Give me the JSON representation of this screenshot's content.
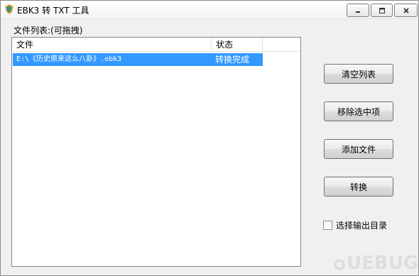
{
  "window": {
    "title": "EBK3 转 TXT 工具"
  },
  "list": {
    "caption": "文件列表:(可拖拽)",
    "columns": [
      "文件",
      "状态"
    ],
    "rows": [
      {
        "file": "E:\\《历史原来这么八卦》.ebk3",
        "status": "转换完成",
        "selected": true
      }
    ]
  },
  "buttons": {
    "clear": "清空列表",
    "remove": "移除选中项",
    "add": "添加文件",
    "convert": "转换"
  },
  "options": {
    "select_output_dir": "选择输出目录",
    "select_output_dir_checked": false
  },
  "colors": {
    "selection": "#3399ff",
    "window_bg": "#f0f0f0"
  },
  "icons": {
    "app": "app-logo-icon",
    "minimize": "minimize-icon",
    "maximize": "maximize-icon",
    "close": "close-icon"
  },
  "watermark": {
    "text": "UEBUG"
  }
}
